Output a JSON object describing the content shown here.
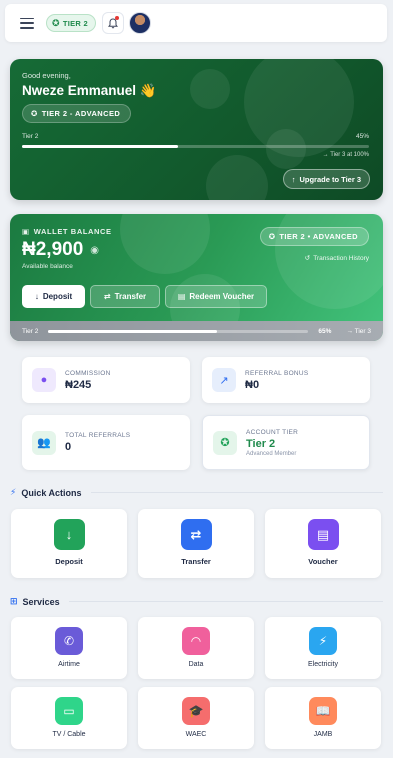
{
  "topbar": {
    "tier_chip": "TIER 2"
  },
  "greeting_card": {
    "greeting": "Good evening,",
    "name": "Nweze Emmanuel",
    "wave_emoji": "👋",
    "tier_badge": "TIER 2 - ADVANCED",
    "progress_label": "Tier 2",
    "progress_percent_text": "45%",
    "progress_value": 45,
    "progress_target": "→ Tier 3 at 100%",
    "upgrade_button": "Upgrade to Tier 3"
  },
  "wallet": {
    "title": "WALLET BALANCE",
    "balance": "₦2,900",
    "balance_sub": "Available balance",
    "tier_badge": "TIER 2 • ADVANCED",
    "transaction_history": "Transaction History",
    "deposit_button": "Deposit",
    "transfer_button": "Transfer",
    "redeem_button": "Redeem Voucher",
    "footer_tier": "Tier 2",
    "footer_percent_text": "65%",
    "footer_progress_value": 65,
    "footer_next": "→ Tier 3"
  },
  "stats": [
    {
      "label": "COMMISSION",
      "value": "₦245"
    },
    {
      "label": "REFERRAL BONUS",
      "value": "₦0"
    },
    {
      "label": "TOTAL REFERRALS",
      "value": "0"
    },
    {
      "label": "ACCOUNT TIER",
      "value": "Tier 2",
      "sub": "Advanced Member"
    }
  ],
  "quick_actions": {
    "title": "Quick Actions",
    "items": [
      {
        "label": "Deposit",
        "icon": "arrow-down-icon",
        "color": "#22a35a"
      },
      {
        "label": "Transfer",
        "icon": "swap-icon",
        "color": "#2f6ef0"
      },
      {
        "label": "Voucher",
        "icon": "voucher-icon",
        "color": "#7b4ff0"
      }
    ]
  },
  "services": {
    "title": "Services",
    "items": [
      {
        "label": "Airtime",
        "icon": "phone-icon",
        "color": "#6a5bd8"
      },
      {
        "label": "Data",
        "icon": "wifi-icon",
        "color": "#f0609c"
      },
      {
        "label": "Electricity",
        "icon": "bolt-icon",
        "color": "#2aa6f0"
      },
      {
        "label": "TV / Cable",
        "icon": "tv-icon",
        "color": "#2fd58a"
      },
      {
        "label": "WAEC",
        "icon": "graduation-cap-icon",
        "color": "#f56d6d"
      },
      {
        "label": "JAMB",
        "icon": "book-icon",
        "color": "#ff8a5c"
      }
    ]
  }
}
